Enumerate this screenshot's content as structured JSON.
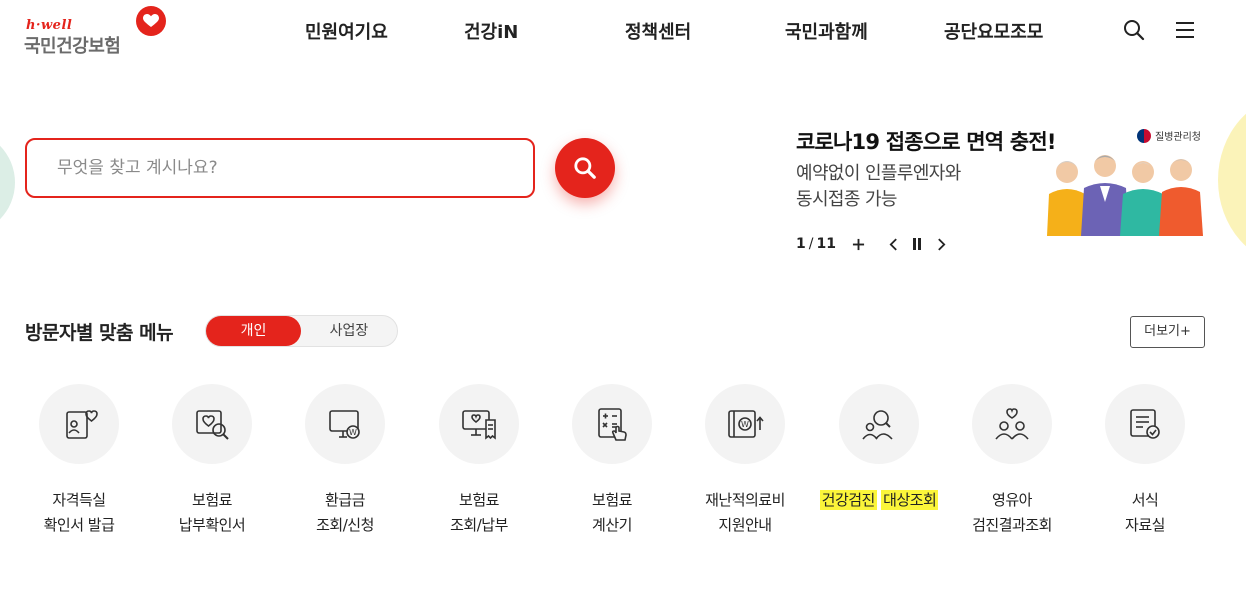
{
  "logo": {
    "tagline": "h·well",
    "name": "국민건강보험"
  },
  "nav": {
    "items": [
      "민원여기요",
      "건강iN",
      "정책센터",
      "국민과함께",
      "공단요모조모"
    ],
    "search_icon": "search-icon",
    "menu_icon": "hamburger-menu-icon"
  },
  "search": {
    "placeholder": "무엇을 찾고 계시나요?",
    "value": ""
  },
  "banner": {
    "title": "코로나19 접종으로 면역 충전!",
    "subtitle_line1": "예약없이 인플루엔자와",
    "subtitle_line2": "동시접종 가능",
    "agency": "질병관리청",
    "current": "1",
    "total": "11"
  },
  "visitor_menu": {
    "title": "방문자별 맞춤 메뉴",
    "tab_personal": "개인",
    "tab_business": "사업장",
    "more": "더보기+",
    "items": [
      {
        "line1": "자격득실",
        "line2": "확인서 발급",
        "icon": "id-card-heart-icon"
      },
      {
        "line1": "보험료",
        "line2": "납부확인서",
        "icon": "heart-search-icon"
      },
      {
        "line1": "환급금",
        "line2": "조회/신청",
        "icon": "monitor-won-icon"
      },
      {
        "line1": "보험료",
        "line2": "조회/납부",
        "icon": "monitor-receipt-icon"
      },
      {
        "line1": "보험료",
        "line2": "계산기",
        "icon": "calculator-icon"
      },
      {
        "line1": "재난적의료비",
        "line2": "지원안내",
        "icon": "book-won-icon"
      },
      {
        "line1": "건강검진",
        "line2": "대상조회",
        "icon": "people-search-icon"
      },
      {
        "line1": "영유아",
        "line2": "검진결과조회",
        "icon": "family-heart-icon"
      },
      {
        "line1": "서식",
        "line2": "자료실",
        "icon": "document-check-icon"
      }
    ]
  },
  "colors": {
    "accent": "#e4241c",
    "highlight": "#fbf53a",
    "deco_green": "#dceee6",
    "deco_yellow": "#fbf3b9"
  }
}
